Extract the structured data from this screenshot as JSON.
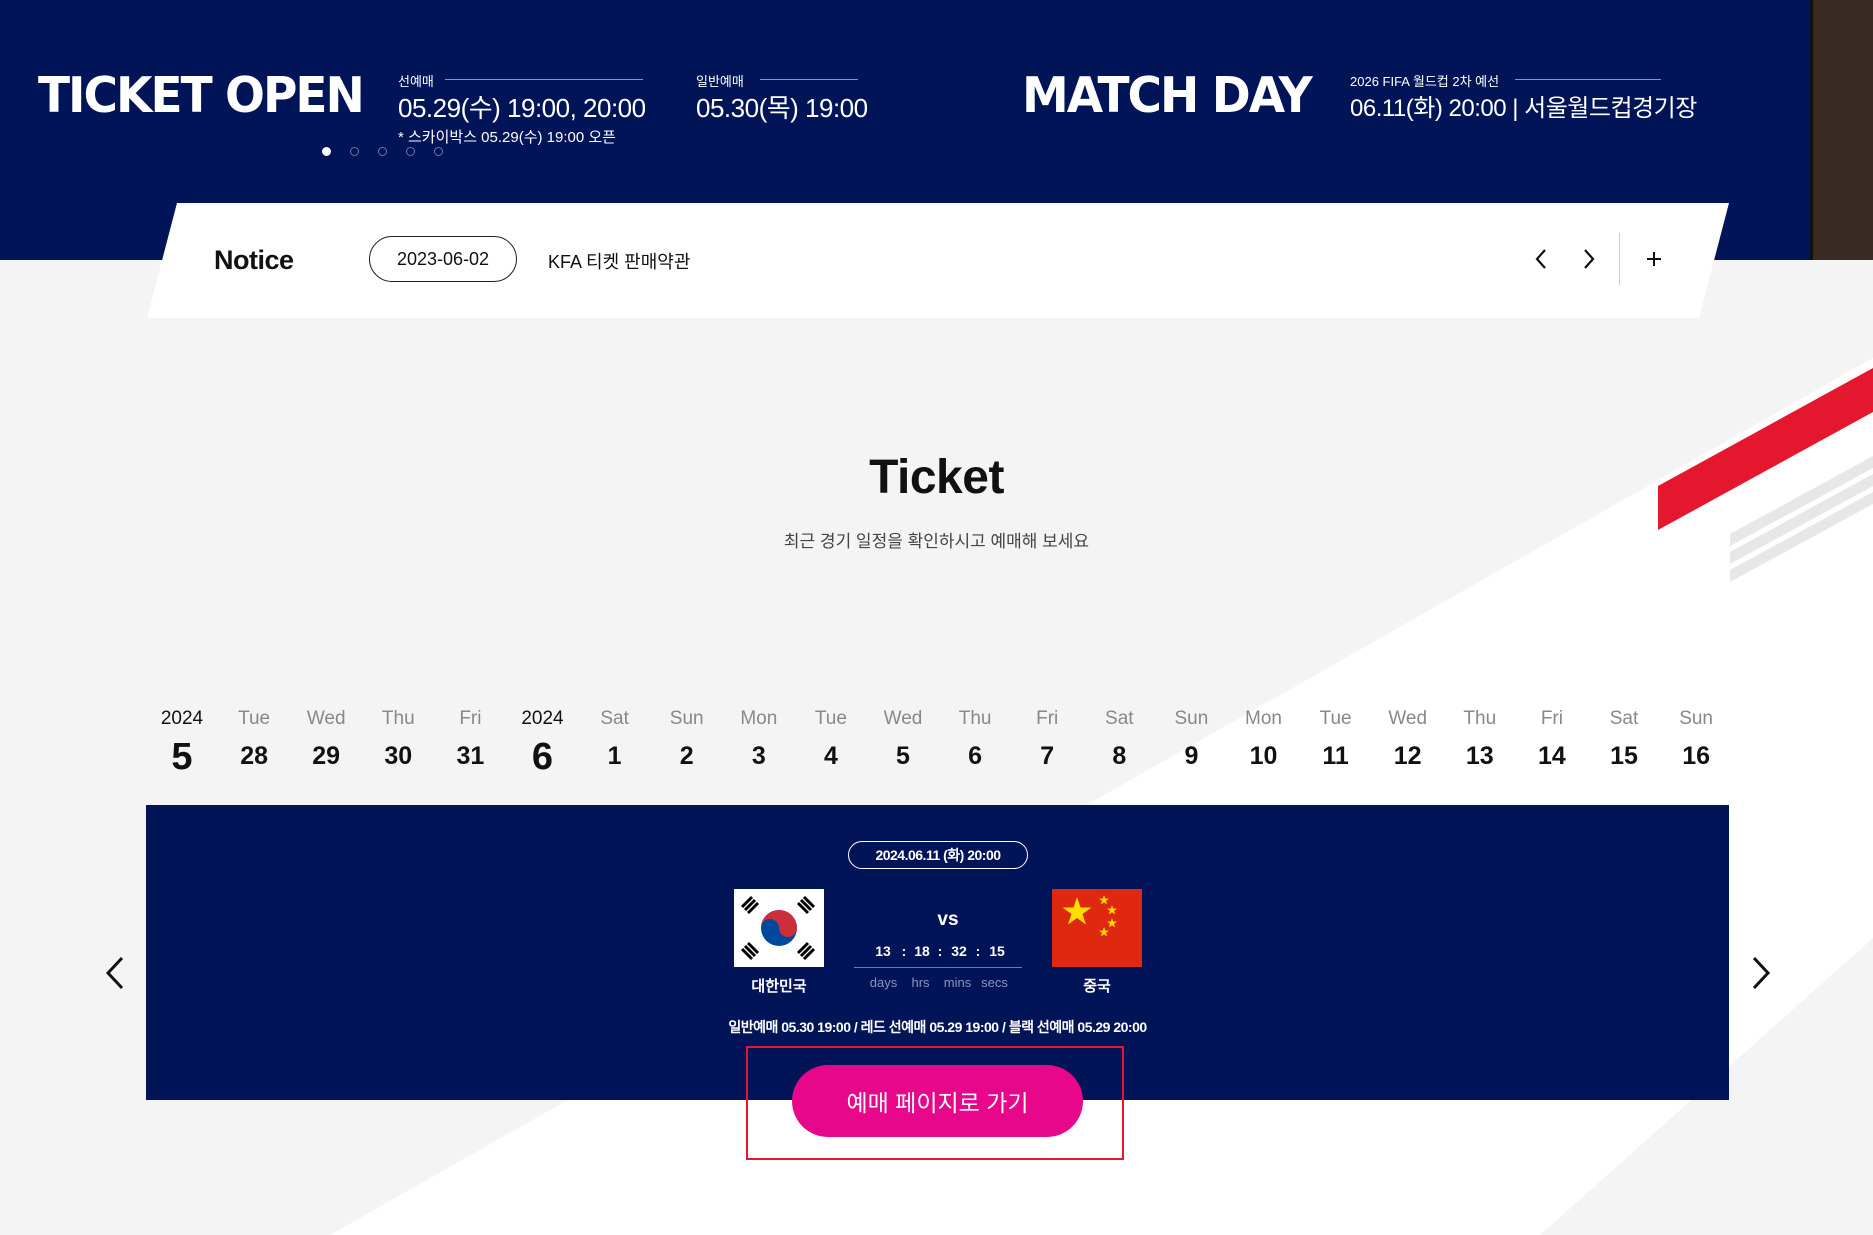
{
  "banner": {
    "ticket_open": "TICKET OPEN",
    "presale_label": "선예매",
    "presale_value": "05.29(수) 19:00, 20:00",
    "presale_note": "* 스카이박스 05.29(수) 19:00 오픈",
    "general_label": "일반예매",
    "general_value": "05.30(목) 19:00",
    "match_day": "MATCH DAY",
    "match_label": "2026 FIFA 월드컵 2차 예선",
    "match_value": "06.11(화) 20:00 | 서울월드컵경기장",
    "slides": 5,
    "active_slide": 1
  },
  "notice": {
    "title": "Notice",
    "date": "2023-06-02",
    "text": "KFA 티켓 판매약관",
    "prev_icon": "chevron-left-icon",
    "next_icon": "chevron-right-icon",
    "more_icon": "plus-icon"
  },
  "ticket": {
    "title": "Ticket",
    "subtitle": "최근 경기 일정을 확인하시고 예매해 보세요"
  },
  "calendar": [
    {
      "top": "2024",
      "bottom": "5",
      "type": "month"
    },
    {
      "top": "Tue",
      "bottom": "28"
    },
    {
      "top": "Wed",
      "bottom": "29"
    },
    {
      "top": "Thu",
      "bottom": "30"
    },
    {
      "top": "Fri",
      "bottom": "31"
    },
    {
      "top": "2024",
      "bottom": "6",
      "type": "month"
    },
    {
      "top": "Sat",
      "bottom": "1"
    },
    {
      "top": "Sun",
      "bottom": "2"
    },
    {
      "top": "Mon",
      "bottom": "3"
    },
    {
      "top": "Tue",
      "bottom": "4"
    },
    {
      "top": "Wed",
      "bottom": "5"
    },
    {
      "top": "Thu",
      "bottom": "6"
    },
    {
      "top": "Fri",
      "bottom": "7"
    },
    {
      "top": "Sat",
      "bottom": "8"
    },
    {
      "top": "Sun",
      "bottom": "9"
    },
    {
      "top": "Mon",
      "bottom": "10"
    },
    {
      "top": "Tue",
      "bottom": "11"
    },
    {
      "top": "Wed",
      "bottom": "12"
    },
    {
      "top": "Thu",
      "bottom": "13"
    },
    {
      "top": "Fri",
      "bottom": "14"
    },
    {
      "top": "Sat",
      "bottom": "15"
    },
    {
      "top": "Sun",
      "bottom": "16"
    }
  ],
  "match": {
    "datetime": "2024.06.11 (화) 20:00",
    "home": "대한민국",
    "away": "중국",
    "vs": "vs",
    "countdown": {
      "days": "13",
      "hrs": "18",
      "mins": "32",
      "secs": "15",
      "sep": ":"
    },
    "units": {
      "days": "days",
      "hrs": "hrs",
      "mins": "mins",
      "secs": "secs"
    },
    "info": "일반예매 05.30 19:00 / 레드 선예매 05.29 19:00 / 블랙 선예매 05.29 20:00",
    "cta": "예매 페이지로 가기"
  },
  "colors": {
    "navy": "#011457",
    "pink": "#e8078b",
    "red": "#e4172e"
  }
}
